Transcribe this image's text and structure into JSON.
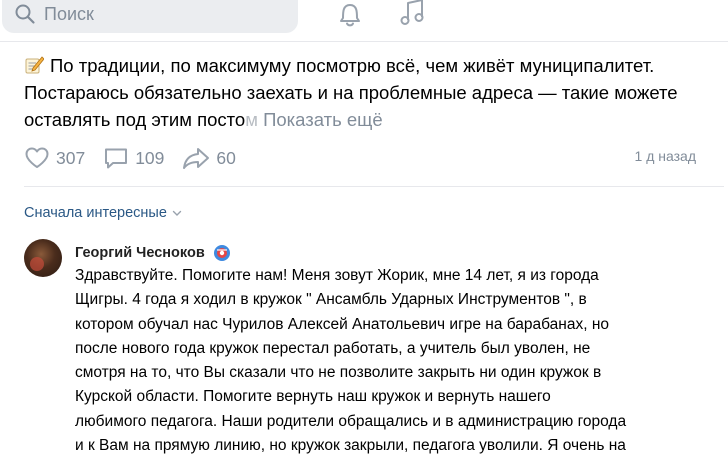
{
  "search": {
    "placeholder": "Поиск"
  },
  "post": {
    "line1": "По традиции, по максимуму посмотрю всё, чем живёт муниципалитет.",
    "line2": "Постараюсь обязательно заехать и на проблемные адреса — такие можете",
    "line3_start": "оставлять под этим посто",
    "line3_fade": "м",
    "show_more": "Показать ещё"
  },
  "actions": {
    "likes": "307",
    "comments": "109",
    "reposts": "60",
    "timestamp": "1 д назад"
  },
  "comments_sort": {
    "label": "Сначала интересные"
  },
  "comment": {
    "author": "Георгий Чесноков",
    "lines": [
      "Здравствуйте. Помогите нам! Меня зовут Жорик, мне 14 лет, я из города",
      "Щигры. 4 года я ходил в кружок \" Ансамбль Ударных Инструментов \", в",
      "котором обучал нас Чурилов Алексей Анатольевич игре на барабанах, но",
      "после нового года кружок перестал работать, а учитель был уволен, не",
      "смотря на то, что Вы сказали что не позволите закрыть ни один кружок в",
      "Курской области. Помогите вернуть наш кружок и вернуть нашего",
      "любимого педагога. Наши родители обращались и в администрацию города",
      "и к Вам на прямую линию, но кружок закрыли, педагога уволили. Я очень на"
    ]
  },
  "colors": {
    "link": "#2a5885",
    "secondary_text": "#818c99",
    "search_bg": "#ebedf0"
  }
}
